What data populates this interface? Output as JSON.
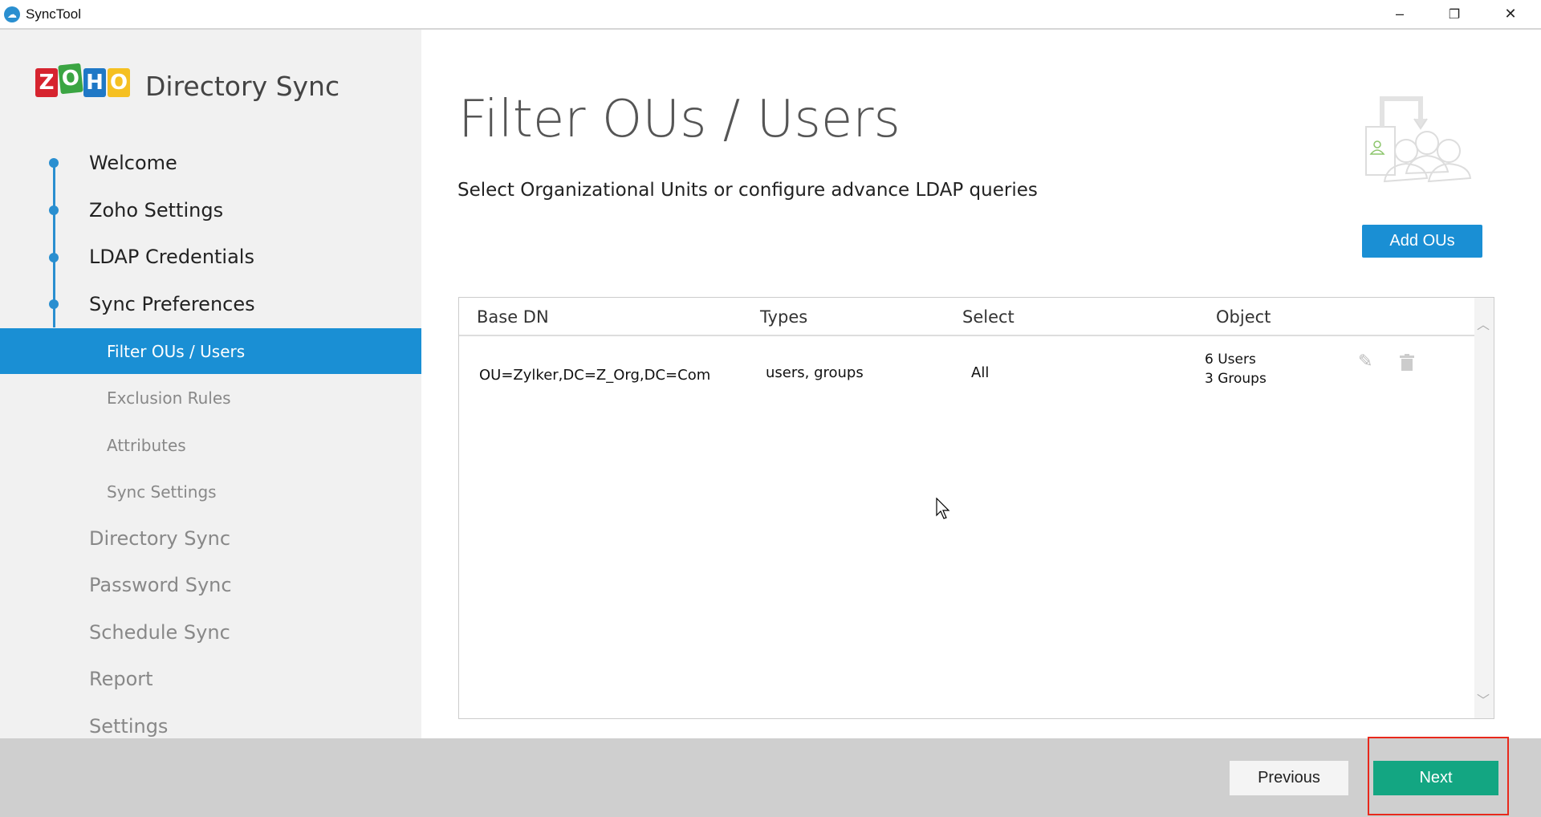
{
  "window": {
    "title": "SyncTool",
    "minimize": "–",
    "restore": "❐",
    "close": "✕"
  },
  "brand": {
    "logo_letters": [
      "Z",
      "O",
      "H",
      "O"
    ],
    "name": "Directory Sync"
  },
  "sidebar": {
    "steps": [
      {
        "label": "Welcome"
      },
      {
        "label": "Zoho Settings"
      },
      {
        "label": "LDAP Credentials"
      },
      {
        "label": "Sync Preferences"
      }
    ],
    "substeps": [
      {
        "label": "Filter OUs / Users",
        "active": true
      },
      {
        "label": "Exclusion Rules"
      },
      {
        "label": "Attributes"
      },
      {
        "label": "Sync Settings"
      }
    ],
    "more": [
      {
        "label": "Directory Sync"
      },
      {
        "label": "Password Sync"
      },
      {
        "label": "Schedule Sync"
      },
      {
        "label": "Report"
      },
      {
        "label": "Settings"
      }
    ]
  },
  "main": {
    "title": "Filter OUs / Users",
    "subtitle": "Select Organizational Units or configure advance LDAP queries",
    "add_button": "Add OUs",
    "table": {
      "headers": [
        "Base DN",
        "Types",
        "Select",
        "Object"
      ],
      "rows": [
        {
          "base_dn": "OU=Zylker,DC=Z_Org,DC=Com",
          "types": "users, groups",
          "select": "All",
          "object_users": "6 Users",
          "object_groups": "3 Groups"
        }
      ]
    }
  },
  "footer": {
    "previous": "Previous",
    "next": "Next"
  },
  "colors": {
    "accent": "#1a8fd4",
    "next": "#13a682",
    "highlight": "#e8291c"
  }
}
